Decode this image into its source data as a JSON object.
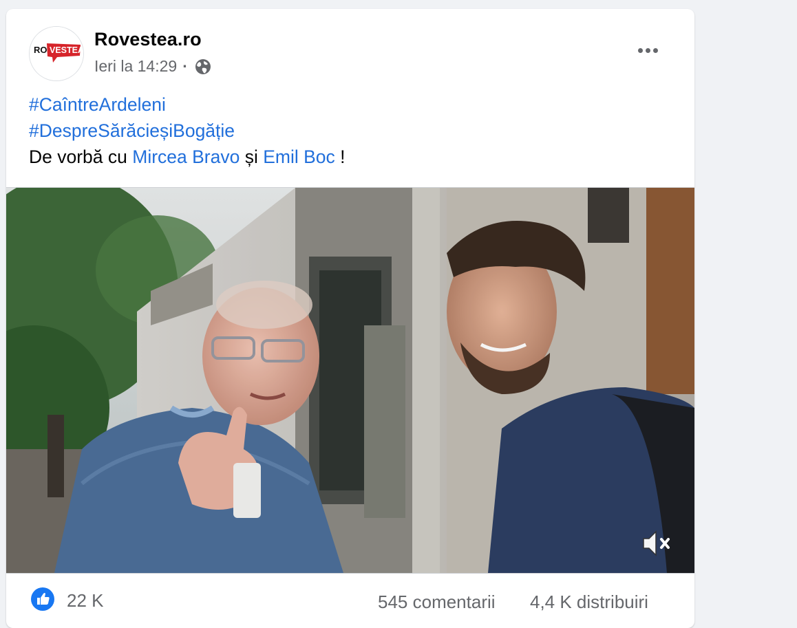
{
  "post": {
    "author": "Rovestea.ro",
    "avatar_logo": {
      "left": "RO",
      "right": "VESTEA"
    },
    "timestamp": "Ieri la 14:29",
    "separator": "·",
    "audience_icon": "globe-icon",
    "more_icon": "more-options-icon",
    "hashtags": [
      "#CaîntreArdeleni",
      "#DespreSărăcieșiBogăție"
    ],
    "body": {
      "prefix": "De vorbă cu ",
      "mention1": "Mircea Bravo",
      "middle": " și ",
      "mention2": "Emil Boc",
      "suffix": " !"
    },
    "video": {
      "muted": true,
      "mute_icon": "speaker-muted-icon"
    },
    "reactions": {
      "icon": "like-icon",
      "count": "22 K"
    },
    "comments": "545 comentarii",
    "shares": "4,4 K distribuiri"
  },
  "colors": {
    "link": "#216fdb",
    "secondary_text": "#65676b",
    "primary_text": "#050505",
    "like_blue": "#1877f2",
    "logo_red": "#d6242a",
    "page_bg": "#f0f2f5"
  }
}
